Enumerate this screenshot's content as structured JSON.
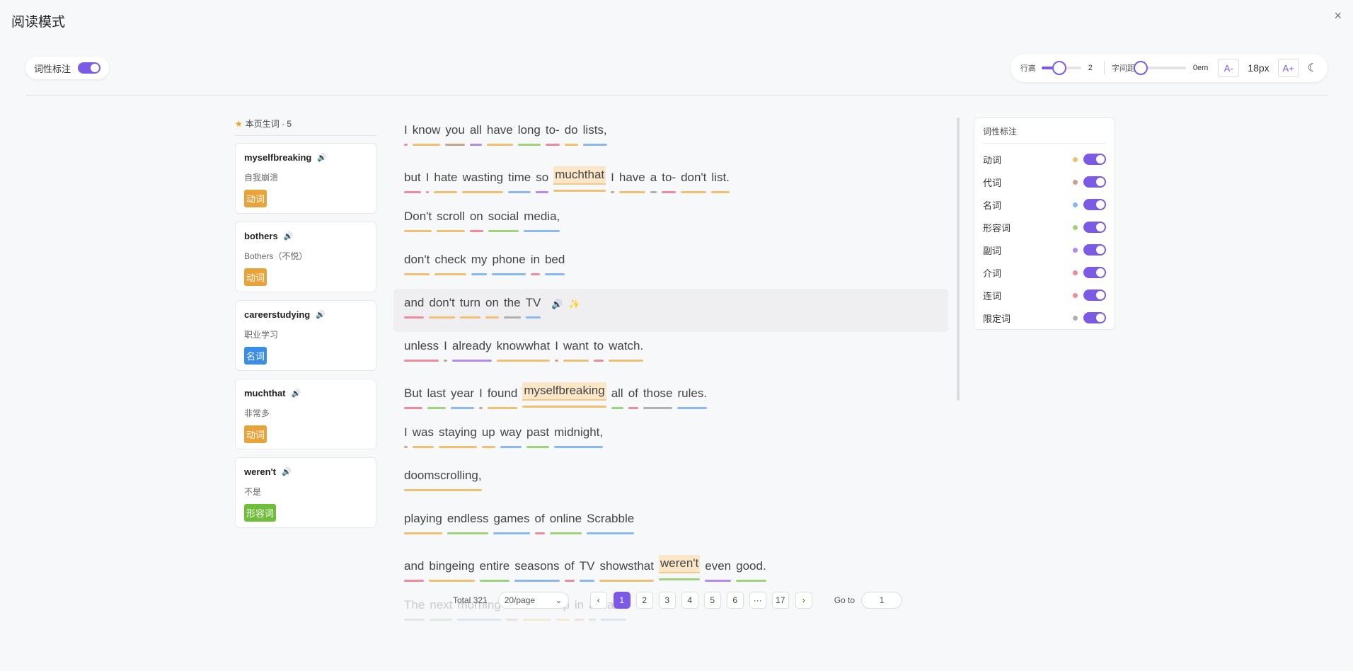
{
  "title": "阅读模式",
  "close_icon": "×",
  "pos_toggle_label": "词性标注",
  "toolbar": {
    "line_height_label": "行高",
    "line_height_value": "2",
    "line_height_level": 0.45,
    "spacing_label": "字间距",
    "spacing_value": "0em",
    "spacing_level": 0.0,
    "font_dec": "A-",
    "font_size": "18px",
    "font_inc": "A+"
  },
  "vocab": {
    "header": "本页生词 · 5",
    "items": [
      {
        "word": "myselfbreaking",
        "meaning": "自我崩溃",
        "tag": "动词",
        "color": "#e8a33a"
      },
      {
        "word": "bothers",
        "meaning": "Bothers（不悦）",
        "tag": "动词",
        "color": "#e8a33a"
      },
      {
        "word": "careerstudying",
        "meaning": "职业学习",
        "tag": "名词",
        "color": "#3a8ee8"
      },
      {
        "word": "muchthat",
        "meaning": "非常多",
        "tag": "动词",
        "color": "#e8a33a"
      },
      {
        "word": "weren't",
        "meaning": "不是",
        "tag": "形容词",
        "color": "#6fbf3a"
      }
    ]
  },
  "lines": [
    {
      "words": [
        [
          "I",
          "#f08a9a"
        ],
        [
          "know",
          "#f0c070"
        ],
        [
          "you",
          "#c8a58a"
        ],
        [
          "all",
          "#b38af0"
        ],
        [
          "have",
          "#f0c070"
        ],
        [
          "long",
          "#9fd27a"
        ],
        [
          "to-",
          "#f08a9a"
        ],
        [
          "do",
          "#f0c070"
        ],
        [
          "lists,",
          "#8ab8f0"
        ]
      ]
    },
    {
      "words": [
        [
          "but",
          "#f08a9a"
        ],
        [
          "I",
          "#f08a9a"
        ],
        [
          "hate",
          "#f0c070"
        ],
        [
          "wasting",
          "#f0c070"
        ],
        [
          "time",
          "#8ab8f0"
        ],
        [
          "so",
          "#b38af0"
        ],
        [
          "muchthat",
          "#f0c070",
          true
        ],
        [
          "I",
          "#c8a58a"
        ],
        [
          "have",
          "#f0c070"
        ],
        [
          "a",
          "#b0b0b0"
        ],
        [
          "to-",
          "#f08a9a"
        ],
        [
          "don't",
          "#f0c070"
        ],
        [
          "list.",
          "#f0c070"
        ]
      ]
    },
    {
      "words": [
        [
          "Don't",
          "#f0c070"
        ],
        [
          "scroll",
          "#f0c070"
        ],
        [
          "on",
          "#f08a9a"
        ],
        [
          "social",
          "#9fd27a"
        ],
        [
          "media,",
          "#8ab8f0"
        ]
      ]
    },
    {
      "words": [
        [
          "don't",
          "#f0c070"
        ],
        [
          "check",
          "#f0c070"
        ],
        [
          "my",
          "#8ab8f0"
        ],
        [
          "phone",
          "#8ab8f0"
        ],
        [
          "in",
          "#f08a9a"
        ],
        [
          "bed",
          "#8ab8f0"
        ]
      ]
    },
    {
      "words": [
        [
          "and",
          "#f08a9a"
        ],
        [
          "don't",
          "#f0c070"
        ],
        [
          "turn",
          "#f0c070"
        ],
        [
          "on",
          "#f0c070"
        ],
        [
          "the",
          "#b0b0b0"
        ],
        [
          "TV",
          "#8ab8f0"
        ]
      ],
      "active": true
    },
    {
      "words": [
        [
          "unless",
          "#f08a9a"
        ],
        [
          "I",
          "#c8a58a"
        ],
        [
          "already",
          "#b38af0"
        ],
        [
          "knowwhat",
          "#f0c070"
        ],
        [
          "I",
          "#c8a58a"
        ],
        [
          "want",
          "#f0c070"
        ],
        [
          "to",
          "#f08a9a"
        ],
        [
          "watch.",
          "#f0c070"
        ]
      ]
    },
    {
      "words": [
        [
          "But",
          "#f08a9a"
        ],
        [
          "last",
          "#9fd27a"
        ],
        [
          "year",
          "#8ab8f0"
        ],
        [
          "I",
          "#c8a58a"
        ],
        [
          "found",
          "#f0c070"
        ],
        [
          "myselfbreaking",
          "#f0c070",
          true
        ],
        [
          "all",
          "#9fd27a"
        ],
        [
          "of",
          "#f08a9a"
        ],
        [
          "those",
          "#b0b0b0"
        ],
        [
          "rules.",
          "#8ab8f0"
        ]
      ]
    },
    {
      "words": [
        [
          "I",
          "#c8a58a"
        ],
        [
          "was",
          "#f0c070"
        ],
        [
          "staying",
          "#f0c070"
        ],
        [
          "up",
          "#f0c070"
        ],
        [
          "way",
          "#8ab8f0"
        ],
        [
          "past",
          "#9fd27a"
        ],
        [
          "midnight,",
          "#8ab8f0"
        ]
      ]
    },
    {
      "words": [
        [
          "doomscrolling,",
          "#f0c070"
        ]
      ]
    },
    {
      "words": [
        [
          "playing",
          "#f0c070"
        ],
        [
          "endless",
          "#9fd27a"
        ],
        [
          "games",
          "#8ab8f0"
        ],
        [
          "of",
          "#f08a9a"
        ],
        [
          "online",
          "#9fd27a"
        ],
        [
          "Scrabble",
          "#8ab8f0"
        ]
      ]
    },
    {
      "words": [
        [
          "and",
          "#f08a9a"
        ],
        [
          "bingeing",
          "#f0c070"
        ],
        [
          "entire",
          "#9fd27a"
        ],
        [
          "seasons",
          "#8ab8f0"
        ],
        [
          "of",
          "#f08a9a"
        ],
        [
          "TV",
          "#8ab8f0"
        ],
        [
          "showsthat",
          "#f0c070"
        ],
        [
          "weren't",
          "#9fd27a",
          true
        ],
        [
          "even",
          "#b38af0"
        ],
        [
          "good.",
          "#9fd27a"
        ]
      ]
    },
    {
      "words": [
        [
          "The",
          "#b0b0b0"
        ],
        [
          "next",
          "#9fd27a"
        ],
        [
          "morning",
          "#8ab8f0"
        ],
        [
          "I'd",
          "#c8a58a"
        ],
        [
          "wake",
          "#f0c070"
        ],
        [
          "up",
          "#f0c070"
        ],
        [
          "in",
          "#f08a9a"
        ],
        [
          "a",
          "#b0b0b0"
        ],
        [
          "daze",
          "#8ab8f0"
        ]
      ],
      "faded": true
    }
  ],
  "pagination": {
    "total": "Total 321",
    "page_size": "20/page",
    "pages": [
      "1",
      "2",
      "3",
      "4",
      "5",
      "6",
      "···",
      "17"
    ],
    "current": "1",
    "goto_label": "Go to",
    "goto_value": "1"
  },
  "pos_panel": {
    "title": "词性标注",
    "items": [
      {
        "label": "动词",
        "color": "#f0c070"
      },
      {
        "label": "代词",
        "color": "#c8a58a"
      },
      {
        "label": "名词",
        "color": "#8ab8f0"
      },
      {
        "label": "形容词",
        "color": "#9fd27a"
      },
      {
        "label": "副词",
        "color": "#b38af0"
      },
      {
        "label": "介词",
        "color": "#f08a9a"
      },
      {
        "label": "连词",
        "color": "#f08a9a"
      },
      {
        "label": "限定词",
        "color": "#b0b0b0"
      }
    ]
  }
}
